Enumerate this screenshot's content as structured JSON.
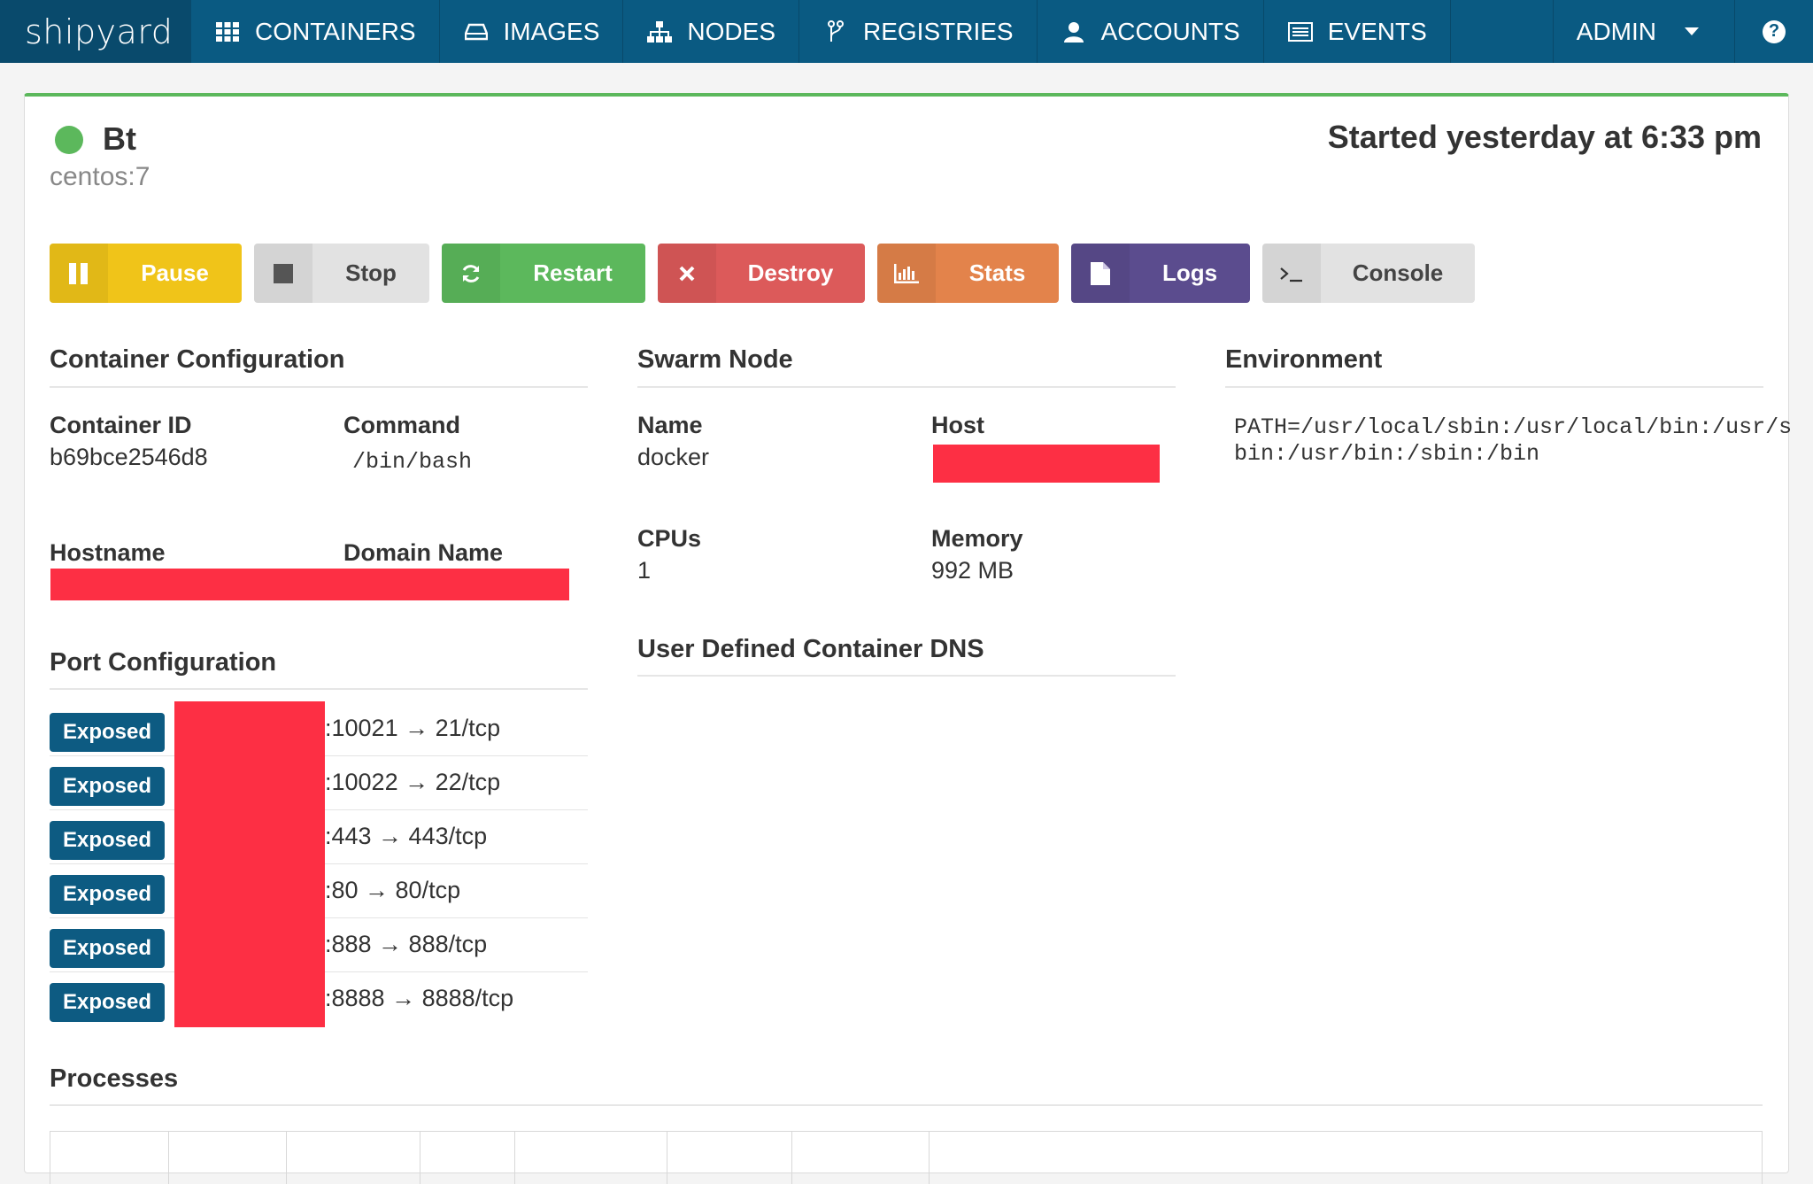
{
  "nav": {
    "brand": "shipyard",
    "items": [
      {
        "label": "CONTAINERS",
        "icon": "grid-icon"
      },
      {
        "label": "IMAGES",
        "icon": "hdd-icon"
      },
      {
        "label": "NODES",
        "icon": "sitemap-icon"
      },
      {
        "label": "REGISTRIES",
        "icon": "fork-icon"
      },
      {
        "label": "ACCOUNTS",
        "icon": "user-icon"
      },
      {
        "label": "EVENTS",
        "icon": "list-icon"
      }
    ],
    "admin_label": "ADMIN",
    "help_symbol": "?"
  },
  "container": {
    "name": "Bt",
    "image": "centos:7",
    "started": "Started yesterday at 6:33 pm",
    "status_color": "#5cb85c"
  },
  "actions": [
    {
      "label": "Pause",
      "icon": "pause-icon",
      "color": "#f0c419",
      "text": "#ffffff"
    },
    {
      "label": "Stop",
      "icon": "stop-icon",
      "color": "#e0e0e0",
      "text": "#444444"
    },
    {
      "label": "Restart",
      "icon": "refresh-icon",
      "color": "#5cb85c",
      "text": "#ffffff"
    },
    {
      "label": "Destroy",
      "icon": "close-icon",
      "color": "#dc5a5a",
      "text": "#ffffff"
    },
    {
      "label": "Stats",
      "icon": "bar-chart-icon",
      "color": "#e3834b",
      "text": "#ffffff"
    },
    {
      "label": "Logs",
      "icon": "file-icon",
      "color": "#5b4c8e",
      "text": "#ffffff"
    },
    {
      "label": "Console",
      "icon": "terminal-icon",
      "color": "#e0e0e0",
      "text": "#444444"
    }
  ],
  "config": {
    "title": "Container Configuration",
    "id_label": "Container ID",
    "id_value": "b69bce2546d8",
    "command_label": "Command",
    "command_value": "/bin/bash",
    "hostname_label": "Hostname",
    "domain_label": "Domain Name"
  },
  "swarm": {
    "title": "Swarm Node",
    "name_label": "Name",
    "name_value": "docker",
    "host_label": "Host",
    "cpus_label": "CPUs",
    "cpus_value": "1",
    "memory_label": "Memory",
    "memory_value": "992 MB"
  },
  "dns": {
    "title": "User Defined Container DNS"
  },
  "environment": {
    "title": "Environment",
    "line1": "PATH=/usr/local/sbin:/usr/local/bin:/usr/s",
    "line2": "bin:/usr/bin:/sbin:/bin"
  },
  "ports": {
    "title": "Port Configuration",
    "rows": [
      {
        "badge": "Exposed",
        "mapping": ":10021 → 21/tcp"
      },
      {
        "badge": "Exposed",
        "mapping": ":10022 → 22/tcp"
      },
      {
        "badge": "Exposed",
        "mapping": ":443 → 443/tcp"
      },
      {
        "badge": "Exposed",
        "mapping": ":80 → 80/tcp"
      },
      {
        "badge": "Exposed",
        "mapping": ":888 → 888/tcp"
      },
      {
        "badge": "Exposed",
        "mapping": ":8888 → 8888/tcp"
      }
    ]
  },
  "processes": {
    "title": "Processes"
  }
}
